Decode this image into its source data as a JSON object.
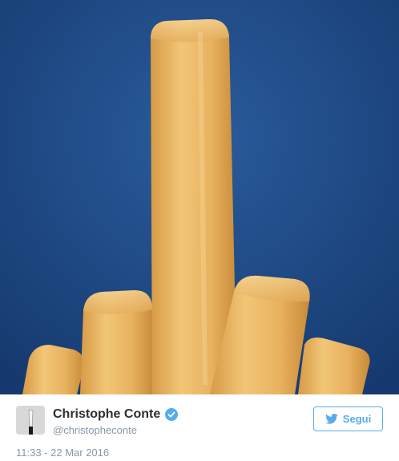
{
  "tweet": {
    "author_name": "Christophe Conte",
    "author_handle": "@christopheconte",
    "follow_label": "Segui",
    "timestamp": "11:33 - 22 Mar 2016",
    "verified": true
  },
  "colors": {
    "accent": "#55acee",
    "photo_background": "#1e4a86",
    "fry": "#e9b561"
  },
  "icons": {
    "verified": "verified-badge-icon",
    "follow": "twitter-bird-icon",
    "avatar": "avatar"
  }
}
